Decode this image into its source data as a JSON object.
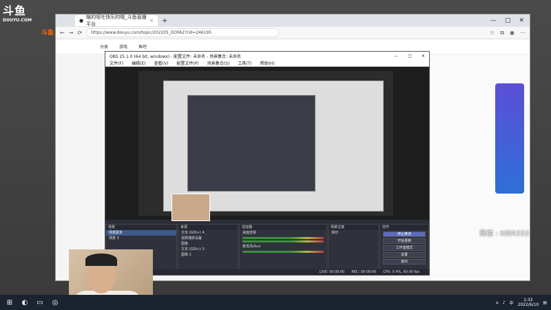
{
  "overlay_logo": {
    "big": "斗鱼",
    "small": "DOUYU.COM"
  },
  "browser": {
    "tab_title": "输的呕吐快乐的哦_斗鱼直播平台",
    "tab_close": "×",
    "new_tab": "+",
    "url": "https://www.douyu.com/topic/202205_DOFA2?rid=246195",
    "win_minimize": "—",
    "win_maximize": "□",
    "win_close": "✕",
    "nav_items": [
      "分类",
      "游戏",
      "鱼吧"
    ],
    "site_logo": "斗鱼"
  },
  "obs": {
    "title": "OBS 25.1.0 (64 bit, windows) - 配置文件: 未命名 - 场景集合: 未命名",
    "menu": [
      "文件(F)",
      "编辑(E)",
      "查看(V)",
      "配置文件(P)",
      "场景集合(S)",
      "工具(T)",
      "帮助(H)"
    ],
    "docks": {
      "scenes": {
        "header": "场景",
        "items": [
          "场景副本",
          "场景 3"
        ]
      },
      "sources": {
        "header": "来源",
        "items": [
          "文本 (GDI+) 4",
          "视频捕获设备",
          "图像",
          "文本 (GDI+) 3",
          "图像 2"
        ]
      },
      "mixer": {
        "header": "混音器",
        "items": [
          "桌面音频",
          "麦克风/Aux"
        ]
      },
      "transitions": {
        "header": "场景过渡",
        "value": "渐切"
      },
      "controls": {
        "header": "控件",
        "buttons": [
          "停止推流",
          "开始录制",
          "工作室模式",
          "设置",
          "退出"
        ]
      }
    },
    "status": {
      "live": "LIVE: 00:00:00",
      "rec": "REC: 00:00:00",
      "cpu": "CPU: 0.4%, 60.00 fps"
    }
  },
  "watermark": "微信 : KIER333",
  "taskbar": {
    "time": "1:32",
    "date": "2022/6/10",
    "lang": "中"
  }
}
